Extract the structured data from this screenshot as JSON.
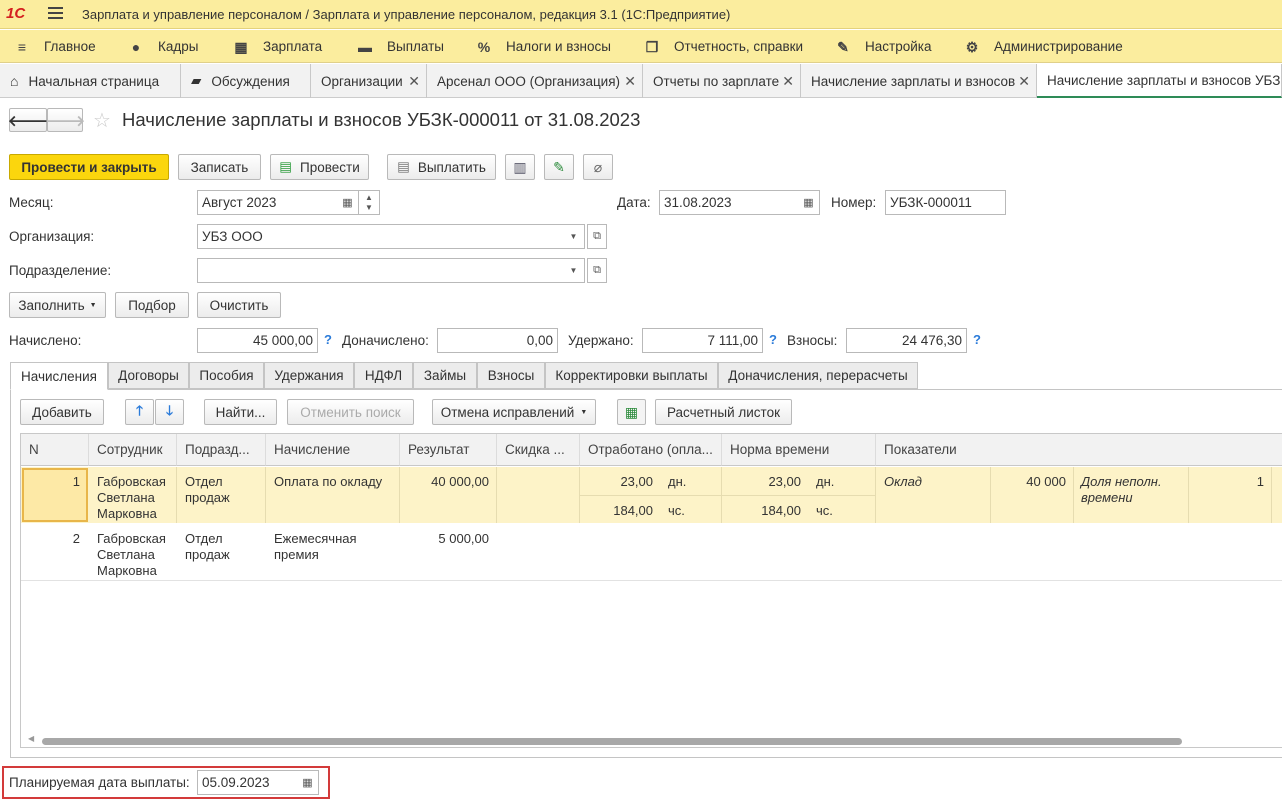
{
  "app": {
    "title": "Зарплата и управление персоналом / Зарплата и управление персоналом, редакция 3.1  (1С:Предприятие)",
    "logo": "1С"
  },
  "menu": [
    {
      "label": "Главное",
      "icon": "menu-icon"
    },
    {
      "label": "Кадры",
      "icon": "people-icon"
    },
    {
      "label": "Зарплата",
      "icon": "calculator-icon"
    },
    {
      "label": "Выплаты",
      "icon": "wallet-icon"
    },
    {
      "label": "Налоги и взносы",
      "icon": "percent-icon"
    },
    {
      "label": "Отчетность, справки",
      "icon": "documents-icon"
    },
    {
      "label": "Настройка",
      "icon": "wrench-icon"
    },
    {
      "label": "Администрирование",
      "icon": "gear-icon"
    }
  ],
  "tabs": [
    {
      "label": "Начальная страница"
    },
    {
      "label": "Обсуждения"
    },
    {
      "label": "Организации"
    },
    {
      "label": "Арсенал ООО (Организация)"
    },
    {
      "label": "Отчеты по зарплате"
    },
    {
      "label": "Начисление зарплаты и взносов"
    },
    {
      "label": "Начисление зарплаты и взносов УБЗК"
    }
  ],
  "doc": {
    "title": "Начисление зарплаты и взносов УБЗК-000011 от 31.08.2023"
  },
  "toolbar": {
    "post_close": "Провести и закрыть",
    "save": "Записать",
    "post": "Провести",
    "pay": "Выплатить"
  },
  "form": {
    "month_label": "Месяц:",
    "month_value": "Август 2023",
    "date_label": "Дата:",
    "date_value": "31.08.2023",
    "number_label": "Номер:",
    "number_value": "УБЗК-000011",
    "org_label": "Организация:",
    "org_value": "УБЗ ООО",
    "dept_label": "Подразделение:",
    "dept_value": "",
    "fill": "Заполнить",
    "pick": "Подбор",
    "clear": "Очистить",
    "accrued_label": "Начислено:",
    "accrued_value": "45 000,00",
    "extra_label": "Доначислено:",
    "extra_value": "0,00",
    "withheld_label": "Удержано:",
    "withheld_value": "7 111,00",
    "contrib_label": "Взносы:",
    "contrib_value": "24 476,30",
    "help": "?"
  },
  "doc_tabs": [
    "Начисления",
    "Договоры",
    "Пособия",
    "Удержания",
    "НДФЛ",
    "Займы",
    "Взносы",
    "Корректировки выплаты",
    "Доначисления, перерасчеты"
  ],
  "grid_toolbar": {
    "add": "Добавить",
    "find": "Найти...",
    "cancel_search": "Отменить поиск",
    "cancel_fix": "Отмена исправлений",
    "payslip": "Расчетный листок"
  },
  "grid": {
    "columns": [
      "N",
      "Сотрудник",
      "Подразд...",
      "Начисление",
      "Результат",
      "Скидка ...",
      "Отработано (опла...",
      "Норма времени",
      "Показатели"
    ],
    "rows": [
      {
        "n": "1",
        "employee": "Габровская Светлана Марковна",
        "dept": "Отдел продаж",
        "accrual": "Оплата по окладу",
        "result": "40 000,00",
        "worked_days": "23,00",
        "worked_days_unit": "дн.",
        "worked_hours": "184,00",
        "worked_hours_unit": "чс.",
        "norm_days": "23,00",
        "norm_days_unit": "дн.",
        "norm_hours": "184,00",
        "norm_hours_unit": "чс.",
        "ind1_name": "Оклад",
        "ind1_value": "40 000",
        "ind2_name": "Доля неполн. времени",
        "ind2_value": "1"
      },
      {
        "n": "2",
        "employee": "Габровская Светлана Марковна",
        "dept": "Отдел продаж",
        "accrual": "Ежемесячная премия",
        "result": "5 000,00"
      }
    ]
  },
  "footer": {
    "pay_date_label": "Планируемая дата выплаты:",
    "pay_date_value": "05.09.2023"
  }
}
